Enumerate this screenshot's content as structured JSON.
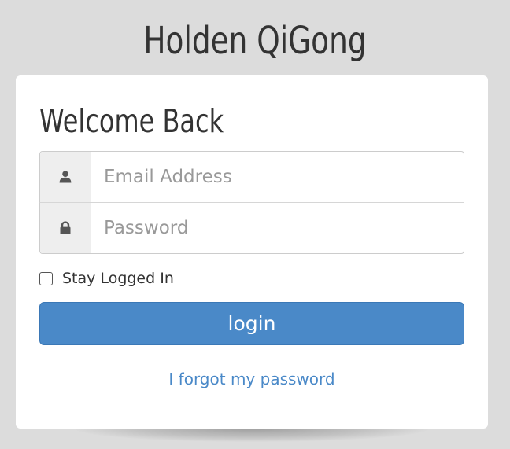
{
  "brand": {
    "title": "Holden QiGong"
  },
  "login_card": {
    "heading": "Welcome Back",
    "email": {
      "placeholder": "Email Address",
      "value": "",
      "icon": "user-icon"
    },
    "password": {
      "placeholder": "Password",
      "value": "",
      "icon": "lock-icon"
    },
    "remember_me": {
      "label": "Stay Logged In",
      "checked": false
    },
    "login_button": {
      "label": "login"
    },
    "forgot_link": {
      "label": "I forgot my password"
    }
  },
  "colors": {
    "page_background": "#dcdcdc",
    "card_background": "#ffffff",
    "primary_button": "#4a89c8",
    "link": "#4a89c8",
    "addon_background": "#eeeeee",
    "text": "#333333"
  }
}
